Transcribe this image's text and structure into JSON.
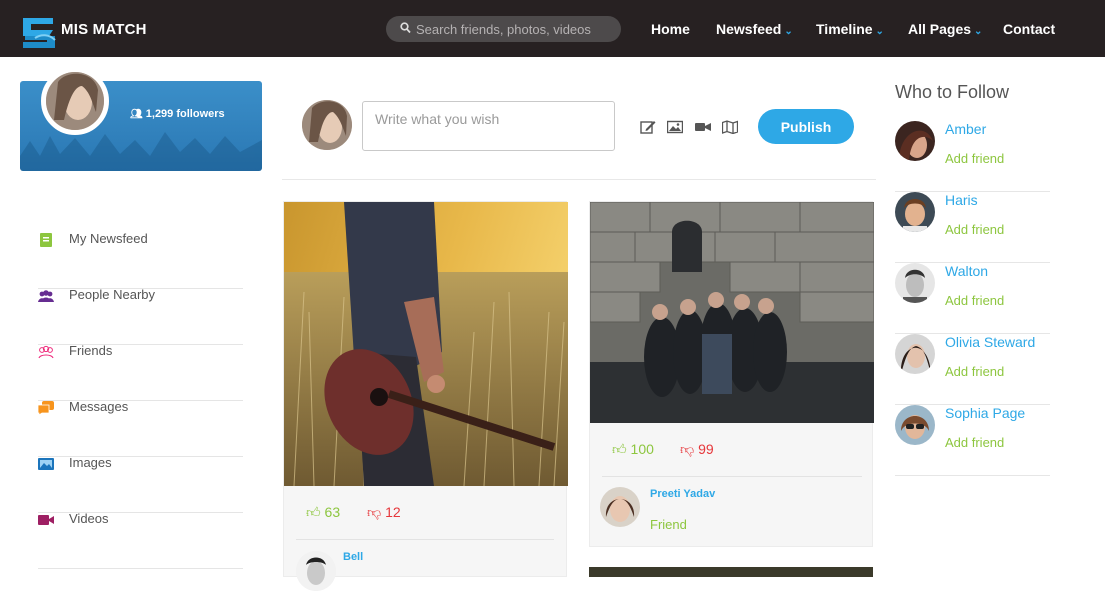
{
  "header": {
    "brand": "MIS MATCH",
    "search_placeholder": "Search friends, photos, videos",
    "nav": [
      {
        "label": "Home",
        "dropdown": false
      },
      {
        "label": "Newsfeed",
        "dropdown": true
      },
      {
        "label": "Timeline",
        "dropdown": true
      },
      {
        "label": "All Pages",
        "dropdown": true
      },
      {
        "label": "Contact",
        "dropdown": false
      }
    ]
  },
  "profile": {
    "followers": "1,299 followers"
  },
  "sidebar": {
    "items": [
      {
        "label": "My Newsfeed",
        "icon": "newsfeed-icon",
        "color": "#8dc63f"
      },
      {
        "label": "People Nearby",
        "icon": "people-nearby-icon",
        "color": "#662d91"
      },
      {
        "label": "Friends",
        "icon": "friends-icon",
        "color": "#ee2a7b"
      },
      {
        "label": "Messages",
        "icon": "messages-icon",
        "color": "#f7941d"
      },
      {
        "label": "Images",
        "icon": "images-icon",
        "color": "#1c75bc"
      },
      {
        "label": "Videos",
        "icon": "videos-icon",
        "color": "#9e1f63"
      }
    ]
  },
  "composer": {
    "placeholder": "Write what you wish",
    "tools": [
      "edit-icon",
      "image-icon",
      "video-icon",
      "map-icon"
    ],
    "publish_label": "Publish"
  },
  "posts": [
    {
      "likes": "63",
      "dislikes": "12",
      "author": "Bell",
      "photo": "guitar-field-photo"
    },
    {
      "likes": "100",
      "dislikes": "99",
      "author": "Preeti Yadav",
      "relation": "Friend",
      "photo": "group-selfie-photo"
    }
  ],
  "who_to_follow": {
    "title": "Who to Follow",
    "people": [
      {
        "name": "Amber",
        "action": "Add friend"
      },
      {
        "name": "Haris",
        "action": "Add friend"
      },
      {
        "name": "Walton",
        "action": "Add friend"
      },
      {
        "name": "Olivia Steward",
        "action": "Add friend"
      },
      {
        "name": "Sophia Page",
        "action": "Add friend"
      }
    ]
  },
  "colors": {
    "header_bg": "#272122",
    "accent_blue": "#2ea8e6",
    "like_green": "#8dc63f",
    "dislike_red": "#e6373b"
  }
}
